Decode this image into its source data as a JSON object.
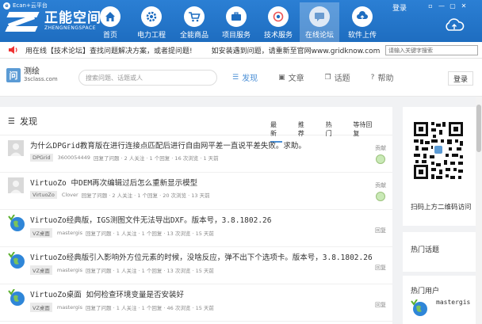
{
  "window": {
    "app_label": "Ecan+云平台",
    "login_label": "登录",
    "controls": [
      "▫",
      "—",
      "▢",
      "✕"
    ]
  },
  "brand": {
    "name_cn": "正能空间",
    "name_en": "ZHENGNENGSPACE"
  },
  "nav": [
    {
      "label": "首页",
      "icon": "home-icon"
    },
    {
      "label": "电力工程",
      "icon": "gear-icon"
    },
    {
      "label": "全能商品",
      "icon": "cart-icon"
    },
    {
      "label": "项目服务",
      "icon": "briefcase-icon"
    },
    {
      "label": "技术服务",
      "icon": "settings-icon"
    },
    {
      "label": "在线论坛",
      "icon": "forum-icon",
      "active": true
    },
    {
      "label": "软件上传",
      "icon": "upload-icon"
    }
  ],
  "notice": {
    "message": "用在线【技术论坛】查找问题解决方案，或者提问题!",
    "message2": "如安装遇到问题，请重新至官网www.gridknow.com",
    "search_placeholder": "请输入关键字搜索"
  },
  "site": {
    "logo_char": "问",
    "name": "测绘",
    "domain": "3sclass.com",
    "search_placeholder": "搜索问题、话题或人",
    "tabs": [
      {
        "label": "发现",
        "icon": "☰",
        "active": true
      },
      {
        "label": "文章",
        "icon": "▣"
      },
      {
        "label": "话题",
        "icon": "❐"
      },
      {
        "label": "帮助",
        "icon": "?"
      }
    ],
    "login_button": "登录"
  },
  "main": {
    "title": "发现",
    "subtabs": [
      "最新",
      "推荐",
      "热门",
      "等待回复"
    ],
    "active_subtab": "最新",
    "questions": [
      {
        "title": "为什么DPGrid教育版在进行连接点匹配后进行自由网平差一直说平差失败。求助。",
        "tag": "DPGrid",
        "user": "3600054449",
        "meta": "回复了问题 · 2 人关注 · 1 个回复 · 16 次浏览 · 1 天前",
        "right_label": "贡献",
        "avatar": "gray",
        "badge": true
      },
      {
        "title": "VirtuoZo 中DEM再次编辑过后怎么重新显示模型",
        "tag": "VirtuoZo",
        "user": "Clover",
        "meta": "回复了问题 · 2 人关注 · 1 个回复 · 20 次浏览 · 13 天前",
        "right_label": "贡献",
        "avatar": "gray",
        "badge": true
      },
      {
        "title": "VirtuoZo经典版，IGS测图文件无法导出DXF。版本号，3.8.1802.26",
        "tag": "VZ桌面",
        "user": "mastergis",
        "meta": "回复了问题 · 1 人关注 · 1 个回复 · 13 次浏览 · 15 天前",
        "right_label": "回复",
        "avatar": "globe",
        "badge": false
      },
      {
        "title": "VirtuoZo经典版引入影响外方位元素的时候，没啥反应，弹不出下个选项卡。版本号，3.8.1802.26",
        "tag": "VZ桌面",
        "user": "mastergis",
        "meta": "回复了问题 · 1 人关注 · 1 个回复 · 13 次浏览 · 15 天前",
        "right_label": "回复",
        "avatar": "globe",
        "badge": false
      },
      {
        "title": "VirtuoZo桌面 如何检查环境变量是否安装好",
        "tag": "VZ桌面",
        "user": "mastergis",
        "meta": "回复了问题 · 1 人关注 · 1 个回复 · 46 次浏览 · 15 天前",
        "right_label": "回复",
        "avatar": "globe",
        "badge": false
      }
    ]
  },
  "sidebar": {
    "qr_caption": "扫码上方二维码访问",
    "hot_topics": "热门话题",
    "hot_users": "热门用户",
    "hot_user_name": "mastergis"
  }
}
